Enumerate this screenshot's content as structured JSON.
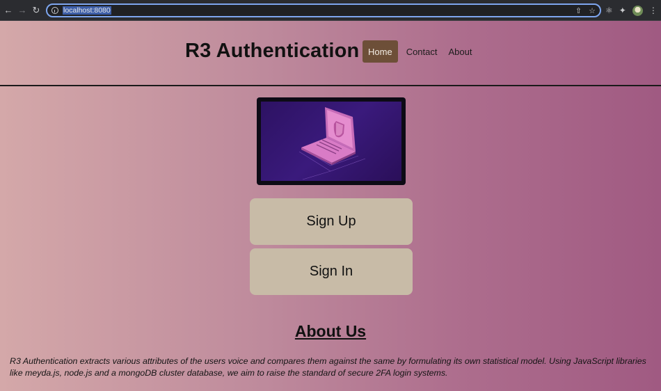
{
  "browser": {
    "url": "localhost:8080"
  },
  "site": {
    "title": "R3 Authentication",
    "nav": [
      "Home",
      "Contact",
      "About"
    ],
    "active_nav": "Home"
  },
  "hero": {
    "image_icon": "laptop-shield-illustration"
  },
  "buttons": {
    "signup": "Sign Up",
    "signin": "Sign In"
  },
  "about": {
    "title": "About Us",
    "text": "R3 Authentication extracts various attributes of the users voice and compares them against the same by formulating its own statistical model. Using JavaScript libraries like meyda.js, node.js and a mongoDB cluster database, we aim to raise the standard of secure 2FA login systems."
  },
  "colors": {
    "active_nav_bg": "#6d4f38",
    "button_bg": "#c8bba7",
    "gradient_start": "#d4a8a9",
    "gradient_end": "#a05a82"
  }
}
